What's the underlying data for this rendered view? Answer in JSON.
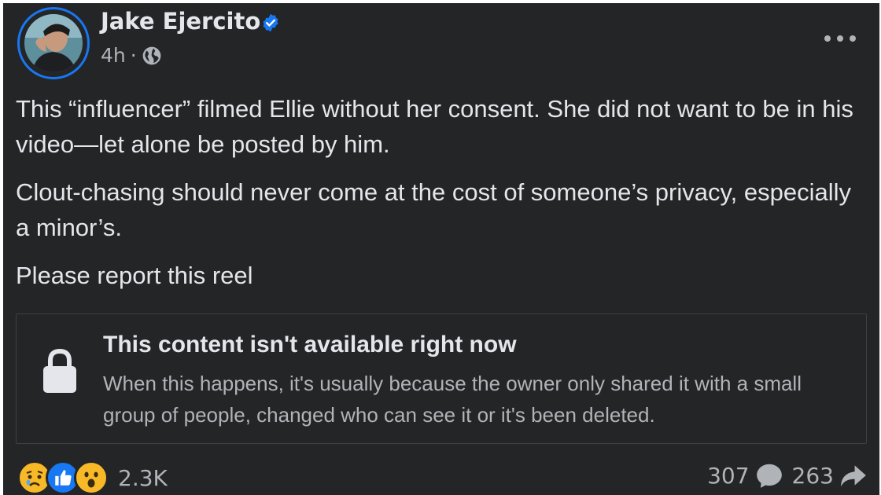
{
  "post": {
    "author": "Jake Ejercito",
    "verified_icon": "verified-badge-icon",
    "time": "4h",
    "separator": "·",
    "audience_icon": "globe-icon",
    "more_icon": "more-options-icon",
    "paragraphs": [
      "This “influencer” filmed Ellie without her consent. She did not want to be in his video—let alone be posted by him.",
      "Clout-chasing should never come at the cost of someone’s privacy, especially a minor’s.",
      "Please report this reel"
    ]
  },
  "attachment": {
    "icon": "lock-icon",
    "title": "This content isn't available right now",
    "description": "When this happens, it's usually because the owner only shared it with a small group of people, changed who can see it or it's been deleted."
  },
  "footer": {
    "reactions": [
      "sad-reaction-icon",
      "like-reaction-icon",
      "wow-reaction-icon"
    ],
    "reaction_count": "2.3K",
    "comment_count": "307",
    "share_count": "263"
  },
  "colors": {
    "background": "#242526",
    "text_primary": "#e4e6eb",
    "text_secondary": "#b0b3b8",
    "accent": "#1877f2"
  }
}
